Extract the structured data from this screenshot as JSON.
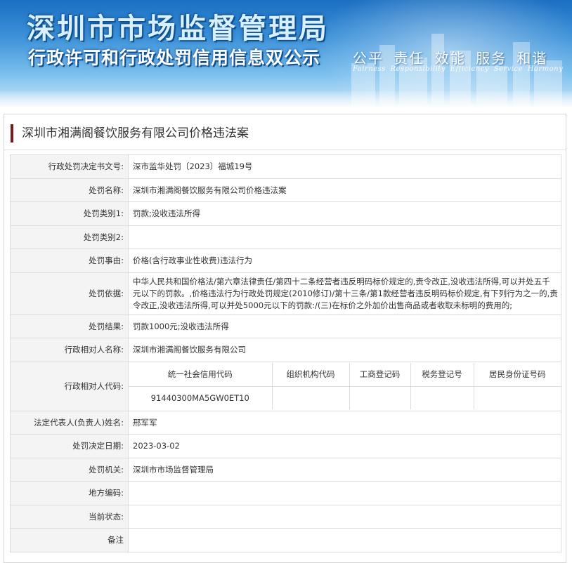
{
  "banner": {
    "title": "深圳市市场监督管理局",
    "subtitle": "行政许可和行政处罚信用信息双公示",
    "slogan": "公平 责任 效能 服务 和谐",
    "slogan_en": "Fairness Responsibility Efficiency Service Harmony"
  },
  "case": {
    "title": "深圳市湘满阁餐饮服务有限公司价格违法案",
    "accent_color": "#7a1b1b"
  },
  "rows": {
    "decision_no": {
      "label": "行政处罚决定书文号:",
      "value": "深市监华处罚〔2023〕福城19号"
    },
    "penalty_name": {
      "label": "处罚名称:",
      "value": "深圳市湘满阁餐饮服务有限公司价格违法案"
    },
    "category1": {
      "label": "处罚类别1:",
      "value": "罚款;没收违法所得"
    },
    "category2": {
      "label": "处罚类别2:",
      "value": ""
    },
    "reason": {
      "label": "处罚事由:",
      "value": "价格(含行政事业性收费)违法行为"
    },
    "basis": {
      "label": "处罚依据:",
      "value": "中华人民共和国价格法/第六章法律责任/第四十二条经营者违反明码标价规定的,责令改正,没收违法所得,可以并处五千元以下的罚款。,价格违法行为行政处罚规定(2010修订)/第十三条/第1款经营者违反明码标价规定,有下列行为之一的,责令改正,没收违法所得,可以并处5000元以下的罚款:/(三)在标价之外加价出售商品或者收取未标明的费用的;"
    },
    "result": {
      "label": "处罚结果:",
      "value": "罚款1000元;没收违法所得"
    },
    "party_name": {
      "label": "行政相对人名称:",
      "value": "深圳市湘满阁餐饮服务有限公司"
    },
    "party_code": {
      "label": "行政相对人代码:",
      "headers": [
        "统一社会信用代码",
        "组织机构代码",
        "工商登记码",
        "税务登记号",
        "居民身份证号码"
      ],
      "values": [
        "91440300MA5GW0ET10",
        "",
        "",
        "",
        ""
      ]
    },
    "legal_rep": {
      "label": "法定代表人(负责人)姓名:",
      "value": "邢军军"
    },
    "decision_date": {
      "label": "处罚决定日期:",
      "value": "2023-03-02"
    },
    "authority": {
      "label": "处罚机关:",
      "value": "深圳市市场监督管理局"
    },
    "local_code": {
      "label": "地方编码:",
      "value": ""
    },
    "status": {
      "label": "当前状态:",
      "value": ""
    },
    "remarks": {
      "label": "备注",
      "value": ""
    }
  }
}
